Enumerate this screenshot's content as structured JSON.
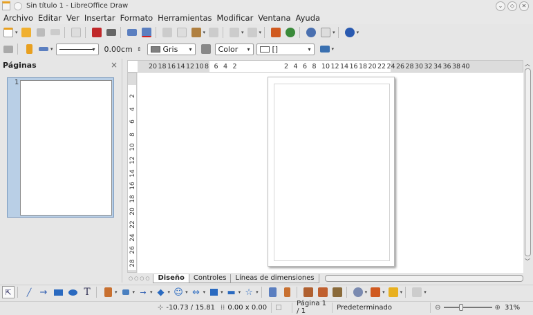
{
  "window": {
    "title": "Sin título 1 - LibreOffice Draw"
  },
  "menubar": {
    "items": [
      "Archivo",
      "Editar",
      "Ver",
      "Insertar",
      "Formato",
      "Herramientas",
      "Modificar",
      "Ventana",
      "Ayuda"
    ]
  },
  "toolbar2": {
    "line_width": "0.00cm",
    "fill_color_name": "Gris",
    "fill_color": "#808080",
    "color_mode": "Color",
    "shadow_value": "[]"
  },
  "sidebar": {
    "title": "Páginas",
    "close": "×",
    "page_number": "1"
  },
  "ruler": {
    "h_left": [
      "20",
      "18",
      "16",
      "14",
      "12",
      "10",
      "8",
      "6",
      "4",
      "2"
    ],
    "h_right": [
      "2",
      "4",
      "6",
      "8",
      "10",
      "12",
      "14",
      "16",
      "18",
      "20",
      "22",
      "24",
      "26",
      "28",
      "30",
      "32",
      "34",
      "36",
      "38",
      "40"
    ],
    "v": [
      "2",
      "4",
      "6",
      "8",
      "10",
      "12",
      "14",
      "16",
      "18",
      "20",
      "22",
      "24",
      "26",
      "28"
    ]
  },
  "tabs": [
    "Diseño",
    "Controles",
    "Líneas de dimensiones"
  ],
  "statusbar": {
    "position": "-10.73 / 15.81",
    "size": "0.00 x 0.00",
    "page": "Página 1 / 1",
    "layout": "Predeterminado",
    "zoom": "31%"
  },
  "colors": {
    "accent": "#e8a020",
    "selection": "#b9cfe6"
  }
}
